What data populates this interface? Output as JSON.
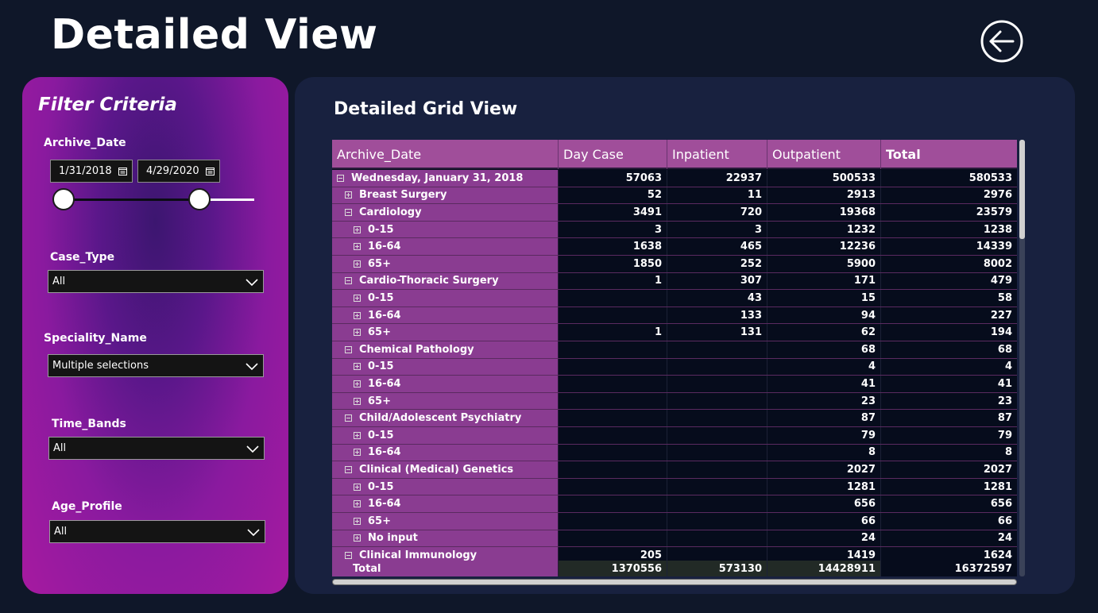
{
  "page": {
    "title": "Detailed View"
  },
  "filters": {
    "title": "Filter Criteria",
    "archive_date": {
      "label": "Archive_Date",
      "start": "1/31/2018",
      "end": "4/29/2020"
    },
    "case_type": {
      "label": "Case_Type",
      "value": "All"
    },
    "speciality_name": {
      "label": "Speciality_Name",
      "value": "Multiple selections"
    },
    "time_bands": {
      "label": "Time_Bands",
      "value": "All"
    },
    "age_profile": {
      "label": "Age_Profile",
      "value": "All"
    }
  },
  "grid": {
    "title": "Detailed Grid View",
    "headers": [
      "Archive_Date",
      "Day Case",
      "Inpatient",
      "Outpatient",
      "Total"
    ],
    "rows": [
      {
        "level": 0,
        "toggle": "minus",
        "label": "Wednesday, January 31, 2018",
        "day_case": "57063",
        "inpatient": "22937",
        "outpatient": "500533",
        "total": "580533"
      },
      {
        "level": 1,
        "toggle": "plus",
        "label": "Breast Surgery",
        "day_case": "52",
        "inpatient": "11",
        "outpatient": "2913",
        "total": "2976"
      },
      {
        "level": 1,
        "toggle": "minus",
        "label": "Cardiology",
        "day_case": "3491",
        "inpatient": "720",
        "outpatient": "19368",
        "total": "23579"
      },
      {
        "level": 2,
        "toggle": "plus",
        "label": "0-15",
        "day_case": "3",
        "inpatient": "3",
        "outpatient": "1232",
        "total": "1238"
      },
      {
        "level": 2,
        "toggle": "plus",
        "label": "16-64",
        "day_case": "1638",
        "inpatient": "465",
        "outpatient": "12236",
        "total": "14339"
      },
      {
        "level": 2,
        "toggle": "plus",
        "label": "65+",
        "day_case": "1850",
        "inpatient": "252",
        "outpatient": "5900",
        "total": "8002"
      },
      {
        "level": 1,
        "toggle": "minus",
        "label": "Cardio-Thoracic Surgery",
        "day_case": "1",
        "inpatient": "307",
        "outpatient": "171",
        "total": "479"
      },
      {
        "level": 2,
        "toggle": "plus",
        "label": "0-15",
        "day_case": "",
        "inpatient": "43",
        "outpatient": "15",
        "total": "58"
      },
      {
        "level": 2,
        "toggle": "plus",
        "label": "16-64",
        "day_case": "",
        "inpatient": "133",
        "outpatient": "94",
        "total": "227"
      },
      {
        "level": 2,
        "toggle": "plus",
        "label": "65+",
        "day_case": "1",
        "inpatient": "131",
        "outpatient": "62",
        "total": "194"
      },
      {
        "level": 1,
        "toggle": "minus",
        "label": "Chemical Pathology",
        "day_case": "",
        "inpatient": "",
        "outpatient": "68",
        "total": "68"
      },
      {
        "level": 2,
        "toggle": "plus",
        "label": "0-15",
        "day_case": "",
        "inpatient": "",
        "outpatient": "4",
        "total": "4"
      },
      {
        "level": 2,
        "toggle": "plus",
        "label": "16-64",
        "day_case": "",
        "inpatient": "",
        "outpatient": "41",
        "total": "41"
      },
      {
        "level": 2,
        "toggle": "plus",
        "label": "65+",
        "day_case": "",
        "inpatient": "",
        "outpatient": "23",
        "total": "23"
      },
      {
        "level": 1,
        "toggle": "minus",
        "label": "Child/Adolescent Psychiatry",
        "day_case": "",
        "inpatient": "",
        "outpatient": "87",
        "total": "87"
      },
      {
        "level": 2,
        "toggle": "plus",
        "label": "0-15",
        "day_case": "",
        "inpatient": "",
        "outpatient": "79",
        "total": "79"
      },
      {
        "level": 2,
        "toggle": "plus",
        "label": "16-64",
        "day_case": "",
        "inpatient": "",
        "outpatient": "8",
        "total": "8"
      },
      {
        "level": 1,
        "toggle": "minus",
        "label": "Clinical (Medical) Genetics",
        "day_case": "",
        "inpatient": "",
        "outpatient": "2027",
        "total": "2027"
      },
      {
        "level": 2,
        "toggle": "plus",
        "label": "0-15",
        "day_case": "",
        "inpatient": "",
        "outpatient": "1281",
        "total": "1281"
      },
      {
        "level": 2,
        "toggle": "plus",
        "label": "16-64",
        "day_case": "",
        "inpatient": "",
        "outpatient": "656",
        "total": "656"
      },
      {
        "level": 2,
        "toggle": "plus",
        "label": "65+",
        "day_case": "",
        "inpatient": "",
        "outpatient": "66",
        "total": "66"
      },
      {
        "level": 2,
        "toggle": "plus",
        "label": "No input",
        "day_case": "",
        "inpatient": "",
        "outpatient": "24",
        "total": "24"
      },
      {
        "level": 1,
        "toggle": "minus",
        "label": "Clinical Immunology",
        "day_case": "205",
        "inpatient": "",
        "outpatient": "1419",
        "total": "1624"
      }
    ],
    "totals": {
      "label": "Total",
      "day_case": "1370556",
      "inpatient": "573130",
      "outpatient": "14428911",
      "total": "16372597"
    }
  },
  "colors": {
    "background": "#0f1729",
    "grid_panel": "#18213f",
    "header_bg": "#a04e9a",
    "row_label_bg": "#8a3c91",
    "values_bg": "#060c1c"
  },
  "icons": {
    "back": "arrow-left-circle-icon",
    "calendar": "calendar-icon",
    "dropdown": "chevron-down-icon",
    "expand": "plus-square-icon",
    "collapse": "minus-square-icon"
  }
}
